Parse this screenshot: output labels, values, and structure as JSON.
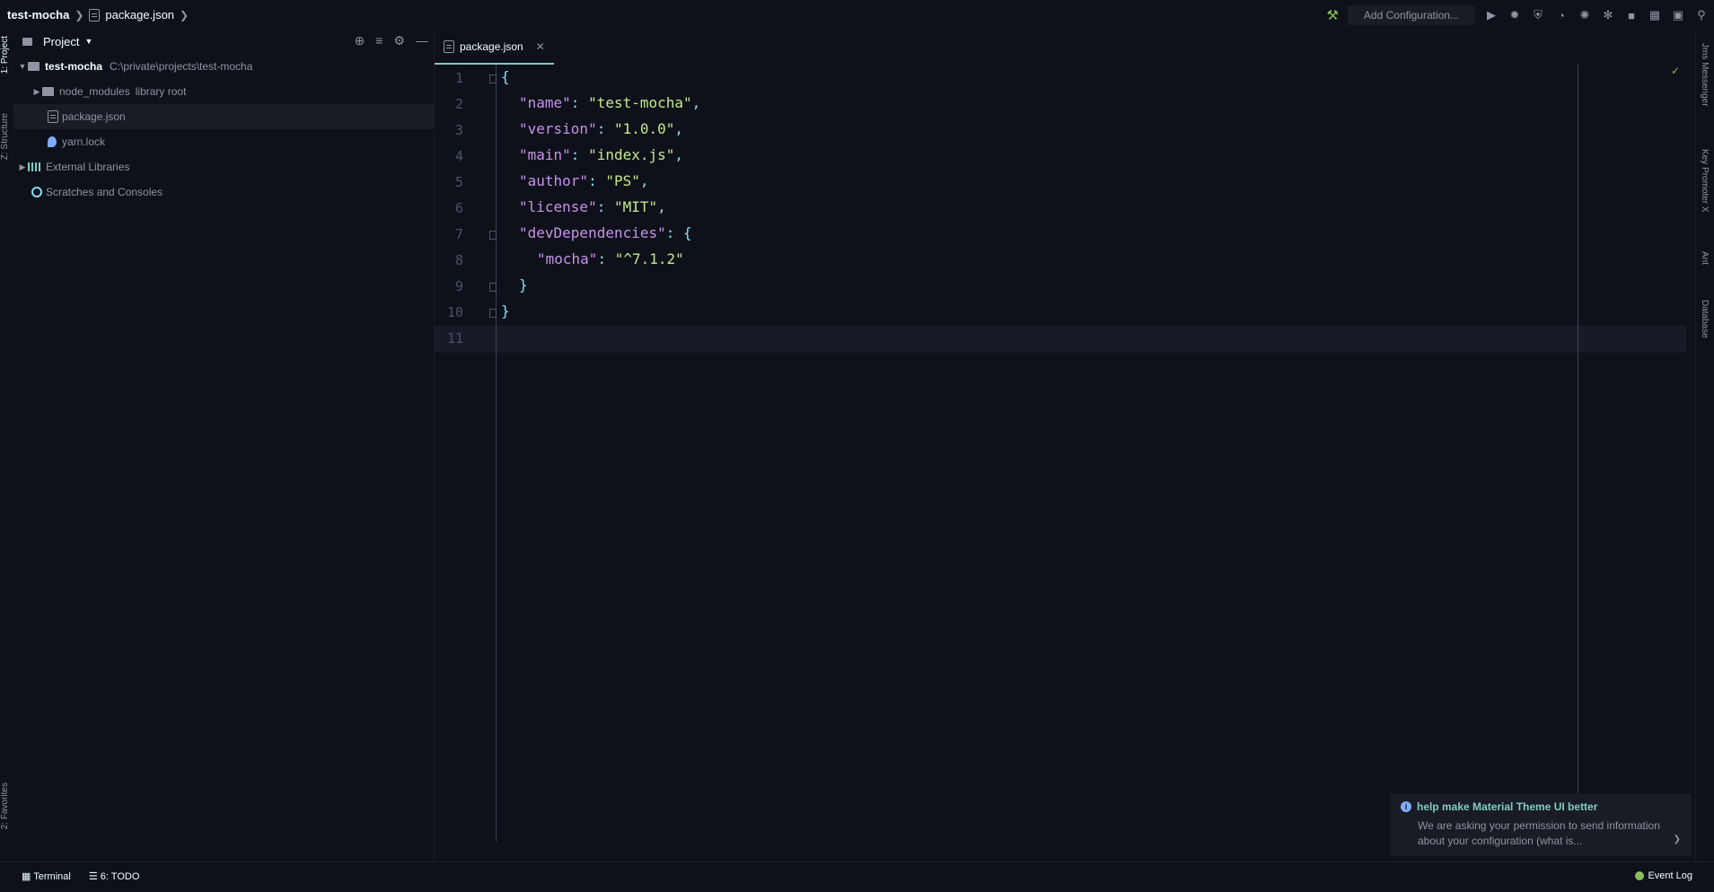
{
  "breadcrumb": {
    "project": "test-mocha",
    "file": "package.json"
  },
  "toolbar": {
    "add_configuration": "Add Configuration..."
  },
  "left_strip": {
    "project_tab": "1: Project",
    "structure_tab": "Z: Structure",
    "favorites_tab": "2: Favorites"
  },
  "project_panel": {
    "title": "Project",
    "tree": {
      "root_name": "test-mocha",
      "root_path": "C:\\private\\projects\\test-mocha",
      "node_modules": "node_modules",
      "node_modules_hint": "library root",
      "package_json": "package.json",
      "yarn_lock": "yarn.lock",
      "external_libraries": "External Libraries",
      "scratches": "Scratches and Consoles"
    }
  },
  "editor": {
    "tab_label": "package.json",
    "lines": [
      {
        "no": "1"
      },
      {
        "no": "2"
      },
      {
        "no": "3"
      },
      {
        "no": "4"
      },
      {
        "no": "5"
      },
      {
        "no": "6"
      },
      {
        "no": "7"
      },
      {
        "no": "8"
      },
      {
        "no": "9"
      },
      {
        "no": "10"
      },
      {
        "no": "11"
      }
    ],
    "code": {
      "name_key": "\"name\"",
      "name_val": "\"test-mocha\"",
      "version_key": "\"version\"",
      "version_val": "\"1.0.0\"",
      "main_key": "\"main\"",
      "main_val": "\"index.js\"",
      "author_key": "\"author\"",
      "author_val": "\"PS\"",
      "license_key": "\"license\"",
      "license_val": "\"MIT\"",
      "devdeps_key": "\"devDependencies\"",
      "mocha_key": "\"mocha\"",
      "mocha_val": "\"^7.1.2\""
    }
  },
  "right_strip": {
    "jms": "Jms Messenger",
    "key_promoter": "Key Promoter X",
    "ant": "Ant",
    "database": "Database"
  },
  "bottom_bar": {
    "terminal": "Terminal",
    "todo": "6: TODO",
    "event_log": "Event Log"
  },
  "notification": {
    "title": "help make Material Theme UI better",
    "body": "We are asking your permission to send information about your configuration (what is..."
  },
  "colors": {
    "background": "#0f111a",
    "accent": "#80cbc4",
    "keyword": "#c792ea",
    "string": "#c3e88d",
    "punct": "#89ddff"
  }
}
